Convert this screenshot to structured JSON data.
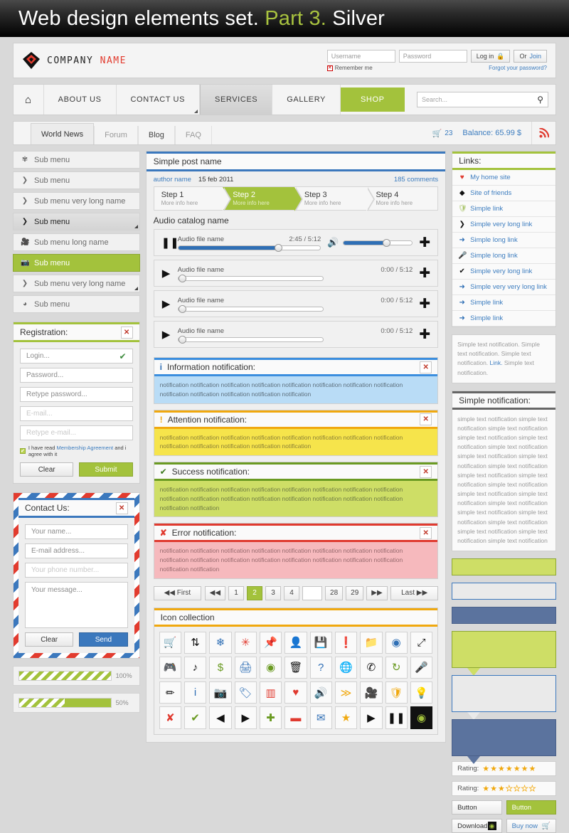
{
  "banner": {
    "text_1": "Web design elements set. ",
    "accent": "Part 3.",
    "text_2": " Silver"
  },
  "header": {
    "logo_company": "COMPANY",
    "logo_name": "NAME",
    "username_placeholder": "Username",
    "password_placeholder": "Password",
    "login_label": "Log in",
    "or_label": "Or",
    "join_label": "Join",
    "remember_label": "Remember me",
    "forgot_label": "Forgot your password?"
  },
  "nav": {
    "items": [
      {
        "label": "ABOUT US",
        "state": "normal"
      },
      {
        "label": "CONTACT US",
        "state": "corner"
      },
      {
        "label": "SERVICES",
        "state": "active"
      },
      {
        "label": "GALLERY",
        "state": "normal"
      },
      {
        "label": "SHOP",
        "state": "shop"
      }
    ],
    "search_placeholder": "Search..."
  },
  "tabs": {
    "items": [
      {
        "label": "World News",
        "active": true
      },
      {
        "label": "Forum",
        "active": false
      },
      {
        "label": "Blog",
        "active": false
      },
      {
        "label": "FAQ",
        "active": false
      }
    ],
    "cart_count": "23",
    "balance": "Balance: 65.99 $"
  },
  "sidebar": {
    "items": [
      {
        "label": "Sub menu",
        "icon": "gear-icon",
        "state": "normal"
      },
      {
        "label": "Sub menu",
        "icon": "arrow-icon",
        "state": "normal"
      },
      {
        "label": "Sub menu very long name",
        "icon": "arrow-icon",
        "state": "normal"
      },
      {
        "label": "Sub menu",
        "icon": "arrow-icon",
        "state": "selected"
      },
      {
        "label": "Sub menu long name",
        "icon": "camera-icon",
        "state": "normal"
      },
      {
        "label": "Sub menu",
        "icon": "photo-icon",
        "state": "green"
      },
      {
        "label": "Sub menu very long name",
        "icon": "arrow-icon",
        "state": "corner"
      },
      {
        "label": "Sub menu",
        "icon": "circle-icon",
        "state": "normal"
      }
    ]
  },
  "registration": {
    "title": "Registration:",
    "fields": [
      {
        "placeholder": "Login...",
        "valid": true
      },
      {
        "placeholder": "Password...",
        "valid": false
      },
      {
        "placeholder": "Retype password...",
        "valid": false
      },
      {
        "placeholder": "E-mail...",
        "valid": false,
        "faded": true
      },
      {
        "placeholder": "Retype e-mail...",
        "valid": false,
        "faded": true
      }
    ],
    "agree_pre": "I have read ",
    "agree_link": "Membership Agreement",
    "agree_post": " and i agree with it",
    "clear_label": "Clear",
    "submit_label": "Submit"
  },
  "contact": {
    "title": "Contact Us:",
    "name_placeholder": "Your name...",
    "email_placeholder": "E-mail address...",
    "phone_placeholder": "Your phone number...",
    "message_placeholder": "Your message...",
    "clear_label": "Clear",
    "send_label": "Send"
  },
  "progress": [
    {
      "value": 100,
      "label": "100%"
    },
    {
      "value": 50,
      "label": "50%"
    }
  ],
  "post": {
    "title": "Simple post name",
    "author": "author name",
    "date": "15 feb 2011",
    "comments": "185 comments",
    "steps": [
      {
        "title": "Step 1",
        "sub": "More info here",
        "active": false
      },
      {
        "title": "Step 2",
        "sub": "More info here",
        "active": true
      },
      {
        "title": "Step 3",
        "sub": "More info here",
        "active": false
      },
      {
        "title": "Step 4",
        "sub": "More info here",
        "active": false
      }
    ],
    "audio_section_title": "Audio catalog name",
    "audio": [
      {
        "name": "Audio file name",
        "time": "2:45 / 5:12",
        "progress": 72,
        "playing": true,
        "volume": 62
      },
      {
        "name": "Audio file name",
        "time": "0:00 / 5:12",
        "progress": 2,
        "playing": false
      },
      {
        "name": "Audio file name",
        "time": "0:00 / 5:12",
        "progress": 2,
        "playing": false
      },
      {
        "name": "Audio file name",
        "time": "0:00 / 5:12",
        "progress": 2,
        "playing": false
      }
    ]
  },
  "notifications": [
    {
      "kind": "info",
      "icon": "info-icon",
      "title": "Information notification:",
      "body": "notification notification notification notification notification notification notification notification notification notification notification notification notification"
    },
    {
      "kind": "warn",
      "icon": "exclamation-icon",
      "title": "Attention notification:",
      "body": "notification notification notification notification notification notification notification notification notification notification notification notification notification"
    },
    {
      "kind": "ok",
      "icon": "check-icon",
      "title": "Success notification:",
      "body": "notification notification notification notification notification notification notification notification notification notification notification notification notification notification notification notification notification notification"
    },
    {
      "kind": "err",
      "icon": "cross-icon",
      "title": "Error notification:",
      "body": "notification notification notification notification notification notification notification notification notification notification notification notification notification notification notification notification notification notification"
    }
  ],
  "pagination": {
    "first_label": "First",
    "last_label": "Last",
    "pages": [
      "1",
      "2",
      "3",
      "4",
      "",
      "28",
      "29"
    ],
    "current": "2"
  },
  "icon_collection": {
    "title": "Icon collection",
    "icons": [
      {
        "n": "cart-icon",
        "g": "🛒",
        "c": "#2f6fb5"
      },
      {
        "n": "sliders-icon",
        "g": "⇅",
        "c": "#111"
      },
      {
        "n": "snowflake-icon",
        "g": "❄",
        "c": "#2f6fb5"
      },
      {
        "n": "asterisk-icon",
        "g": "✳",
        "c": "#e03a2f"
      },
      {
        "n": "pin-icon",
        "g": "📌",
        "c": "#111"
      },
      {
        "n": "user-icon",
        "g": "👤",
        "c": "#6a9a22"
      },
      {
        "n": "save-icon",
        "g": "💾",
        "c": "#111"
      },
      {
        "n": "exclamation-icon",
        "g": "❗",
        "c": "#e03a2f"
      },
      {
        "n": "folder-icon",
        "g": "📁",
        "c": "#f0a80e"
      },
      {
        "n": "disc-icon",
        "g": "◉",
        "c": "#2f6fb5"
      },
      {
        "n": "expand-icon",
        "g": "⤢",
        "c": "#111"
      },
      {
        "n": "gamepad-icon",
        "g": "🎮",
        "c": "#2f6fb5"
      },
      {
        "n": "music-note-icon",
        "g": "♪",
        "c": "#111"
      },
      {
        "n": "dollar-icon",
        "g": "$",
        "c": "#6a9a22"
      },
      {
        "n": "print-icon",
        "g": "🖨",
        "c": "#2f6fb5"
      },
      {
        "n": "eye-icon",
        "g": "◉",
        "c": "#6a9a22"
      },
      {
        "n": "trash-icon",
        "g": "🗑",
        "c": "#111"
      },
      {
        "n": "question-icon",
        "g": "?",
        "c": "#2f6fb5"
      },
      {
        "n": "globe-icon",
        "g": "🌐",
        "c": "#6a9a22"
      },
      {
        "n": "phone-icon",
        "g": "✆",
        "c": "#111"
      },
      {
        "n": "refresh-icon",
        "g": "↻",
        "c": "#6a9a22"
      },
      {
        "n": "microphone-icon",
        "g": "🎤",
        "c": "#111"
      },
      {
        "n": "pen-icon",
        "g": "✏",
        "c": "#111"
      },
      {
        "n": "info-icon",
        "g": "i",
        "c": "#2f6fb5"
      },
      {
        "n": "camera-icon",
        "g": "📷",
        "c": "#6a9a22"
      },
      {
        "n": "tag-icon",
        "g": "🏷",
        "c": "#2f6fb5"
      },
      {
        "n": "chart-icon",
        "g": "▥",
        "c": "#e03a2f"
      },
      {
        "n": "heart-icon",
        "g": "♥",
        "c": "#e03a2f"
      },
      {
        "n": "speaker-icon",
        "g": "🔊",
        "c": "#111"
      },
      {
        "n": "rss-icon",
        "g": "≫",
        "c": "#f0a80e"
      },
      {
        "n": "video-camera-icon",
        "g": "🎥",
        "c": "#111"
      },
      {
        "n": "shield-icon",
        "g": "🛡",
        "c": "#f0a80e"
      },
      {
        "n": "bulb-icon",
        "g": "💡",
        "c": "#6a9a22"
      },
      {
        "n": "cross-icon",
        "g": "✘",
        "c": "#e03a2f"
      },
      {
        "n": "check-icon",
        "g": "✔",
        "c": "#6a9a22"
      },
      {
        "n": "arrow-left-icon",
        "g": "◀",
        "c": "#111"
      },
      {
        "n": "arrow-right-icon",
        "g": "▶",
        "c": "#111"
      },
      {
        "n": "plus-icon",
        "g": "✚",
        "c": "#6a9a22"
      },
      {
        "n": "minus-icon",
        "g": "▬",
        "c": "#e03a2f"
      },
      {
        "n": "mail-icon",
        "g": "✉",
        "c": "#2f6fb5"
      },
      {
        "n": "star-icon",
        "g": "★",
        "c": "#f0a80e"
      },
      {
        "n": "play-icon",
        "g": "▶",
        "c": "#111"
      },
      {
        "n": "pause-icon",
        "g": "❚❚",
        "c": "#111"
      },
      {
        "n": "power-icon",
        "g": "◉",
        "c": "#a3c23c"
      }
    ]
  },
  "links": {
    "title": "Links:",
    "items": [
      {
        "label": "My home site",
        "icon": "heart-icon",
        "color": "#e03a2f"
      },
      {
        "label": "Site of friends",
        "icon": "diamond-icon",
        "color": "#111"
      },
      {
        "label": "Simple link",
        "icon": "shield-icon",
        "color": "#a9c46a"
      },
      {
        "label": "Simple very long link",
        "icon": "arrow-icon",
        "color": "#111"
      },
      {
        "label": "Simple long link",
        "icon": "arrow-right-icon",
        "color": "#2f6fb5"
      },
      {
        "label": "Simple long link",
        "icon": "microphone-icon",
        "color": "#f0a80e"
      },
      {
        "label": "Simple very long link",
        "icon": "check-icon",
        "color": "#111"
      },
      {
        "label": "Simple very very long link",
        "icon": "arrow-right-icon",
        "color": "#2f6fb5"
      },
      {
        "label": "Simple link",
        "icon": "arrow-right-icon",
        "color": "#2f6fb5"
      },
      {
        "label": "Simple link",
        "icon": "arrow-right-icon",
        "color": "#2f6fb5"
      }
    ]
  },
  "right_text": {
    "pre": "Simple text notification. Simple text notification. Simple text notification. ",
    "link": "Link.",
    "post": " Simple text notification."
  },
  "simple_notification": {
    "title": "Simple notification:",
    "body": "simple text notification simple text notification simple text notification simple text notification simple text notification simple text notification simple text notification simple text notification simple text notification simple text notification simple text notification simple text notification simple text notification simple text notification simple text notification simple text notification simple text notification simple text notification simple text notification simple text notification simple text notification"
  },
  "ratings": [
    {
      "label": "Rating:",
      "filled": 7,
      "total": 7
    },
    {
      "label": "Rating:",
      "filled": 3,
      "total": 7
    }
  ],
  "buttons": {
    "plain": "Button",
    "green": "Button",
    "download": "Download",
    "buy": "Buy now"
  },
  "colors": {
    "green": "#a3c23c",
    "blue": "#3b78bd",
    "orange": "#f0a80e",
    "red": "#e03a2f",
    "navy": "#5b739e"
  }
}
